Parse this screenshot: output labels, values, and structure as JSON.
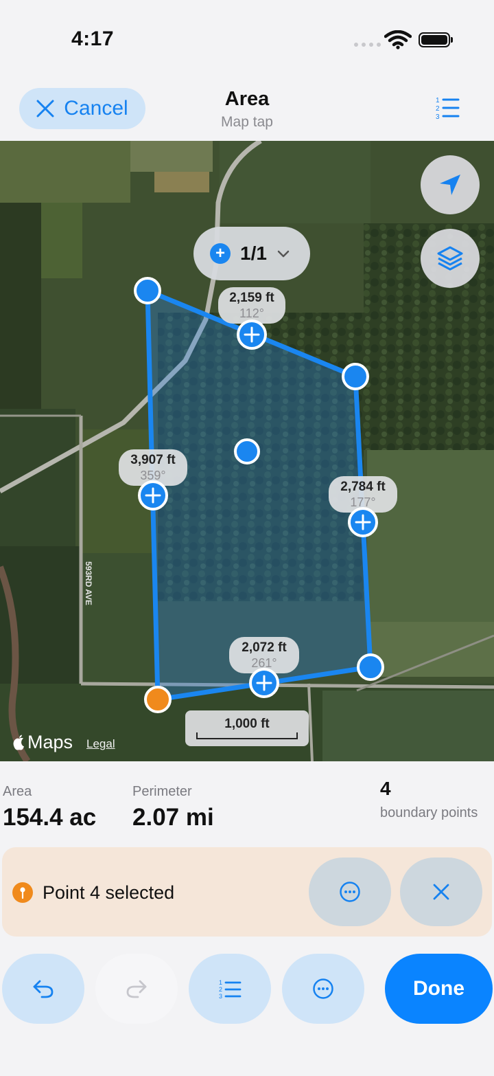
{
  "status_bar": {
    "time": "4:17"
  },
  "nav": {
    "cancel_label": "Cancel",
    "title": "Area",
    "subtitle": "Map tap"
  },
  "map": {
    "selector_label": "1/1",
    "segments": [
      {
        "length": "2,159 ft",
        "bearing": "112°"
      },
      {
        "length": "3,907 ft",
        "bearing": "359°"
      },
      {
        "length": "2,784 ft",
        "bearing": "177°"
      },
      {
        "length": "2,072 ft",
        "bearing": "261°"
      }
    ],
    "road_label": "593RD AVE",
    "scale_label": "1,000 ft",
    "maps_brand": "Maps",
    "legal_link": "Legal",
    "colors": {
      "vertex": "#1a86f0",
      "selected_vertex": "#f08a1c",
      "polygon_line": "#1a86f0"
    }
  },
  "stats": {
    "area_label": "Area",
    "area_value": "154.4 ac",
    "perimeter_label": "Perimeter",
    "perimeter_value": "2.07 mi",
    "points_count": "4",
    "points_label": "boundary points"
  },
  "selection": {
    "text": "Point 4 selected"
  },
  "toolbar": {
    "done_label": "Done"
  },
  "icons": [
    "close-icon",
    "numbered-list-icon",
    "location-arrow-icon",
    "layers-icon",
    "plus-icon",
    "chevron-down-icon",
    "pin-icon",
    "more-icon",
    "undo-icon",
    "redo-icon"
  ]
}
